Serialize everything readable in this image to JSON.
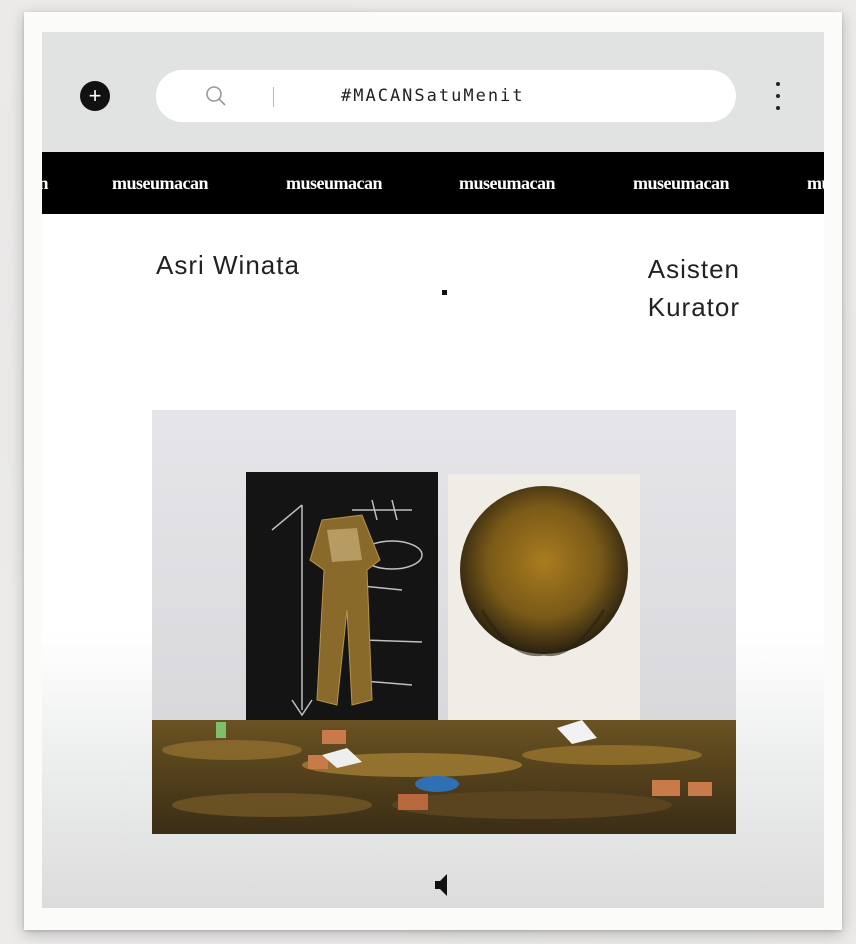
{
  "header": {
    "search": {
      "value": "#MACANSatuMenit"
    }
  },
  "ticker": {
    "items": [
      "museumacan",
      "museumacan",
      "museumacan",
      "museumacan",
      "museumacan",
      "museumacan"
    ]
  },
  "person": {
    "name": "Asri Winata",
    "role_line1": "Asisten",
    "role_line2": "Kurator"
  },
  "icons": [
    "plus-icon",
    "search-icon",
    "kebab-menu-icon",
    "speaker-icon"
  ],
  "colors": {
    "topbar": "#e1e3e2",
    "ticker_bg": "#000000",
    "ticker_text": "#ffffff"
  }
}
